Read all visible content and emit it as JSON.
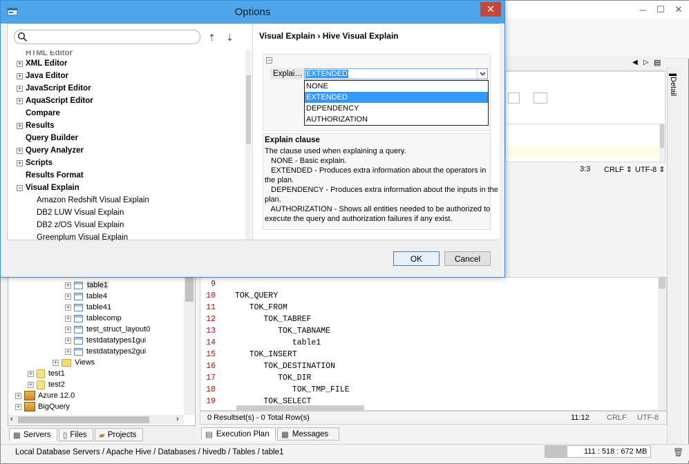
{
  "app": {
    "status_path": "Local Database Servers / Apache Hive / Databases / hivedb / Tables / table1",
    "memory": "111 : 518 : 672 MB",
    "memory_fraction": 0.21,
    "detail_tab": "Detail",
    "editor_status_top": {
      "pos": "3:3",
      "line_ending": "CRLF",
      "encoding": "UTF-8"
    },
    "result_status": {
      "summary": "0 Resultset(s) - 0 Total Row(s)",
      "pos": "11:12",
      "line_ending": "CRLF",
      "encoding": "UTF-8"
    },
    "bottom_tabs_left": [
      "Servers",
      "Files",
      "Projects"
    ],
    "bottom_tabs_right": [
      "Execution Plan",
      "Messages"
    ],
    "tree": [
      {
        "label": "table1",
        "level": 3,
        "type": "table",
        "selected": true
      },
      {
        "label": "table4",
        "level": 3,
        "type": "table"
      },
      {
        "label": "table41",
        "level": 3,
        "type": "table"
      },
      {
        "label": "tablecomp",
        "level": 3,
        "type": "table"
      },
      {
        "label": "test_struct_layout0",
        "level": 3,
        "type": "table"
      },
      {
        "label": "testdatatypes1gui",
        "level": 3,
        "type": "table"
      },
      {
        "label": "testdatatypes2gui",
        "level": 3,
        "type": "table"
      },
      {
        "label": "Views",
        "level": 2,
        "type": "folder"
      },
      {
        "label": "test1",
        "level": 1,
        "type": "db"
      },
      {
        "label": "test2",
        "level": 1,
        "type": "db"
      },
      {
        "label": "Azure 12.0",
        "level": 0,
        "type": "server"
      },
      {
        "label": "BigQuery",
        "level": 0,
        "type": "server"
      }
    ],
    "code_lines": [
      {
        "n": "9",
        "text": ""
      },
      {
        "n": "10",
        "text": "TOK_QUERY"
      },
      {
        "n": "11",
        "text": "   TOK_FROM"
      },
      {
        "n": "12",
        "text": "      TOK_TABREF"
      },
      {
        "n": "13",
        "text": "         TOK_TABNAME"
      },
      {
        "n": "14",
        "text": "            table1"
      },
      {
        "n": "15",
        "text": "   TOK_INSERT"
      },
      {
        "n": "16",
        "text": "      TOK_DESTINATION"
      },
      {
        "n": "17",
        "text": "         TOK_DIR"
      },
      {
        "n": "18",
        "text": "            TOK_TMP_FILE"
      },
      {
        "n": "19",
        "text": "      TOK_SELECT"
      }
    ]
  },
  "dialog": {
    "title": "Options",
    "search_placeholder": "",
    "nav": [
      {
        "label": "HTML Editor",
        "plus": true,
        "bold": true,
        "clipped": true
      },
      {
        "label": "XML Editor",
        "plus": true,
        "bold": true
      },
      {
        "label": "Java Editor",
        "plus": true,
        "bold": true
      },
      {
        "label": "JavaScript Editor",
        "plus": true,
        "bold": true
      },
      {
        "label": "AquaScript Editor",
        "plus": true,
        "bold": true
      },
      {
        "label": "Compare",
        "plus": false,
        "bold": true
      },
      {
        "label": "Results",
        "plus": true,
        "bold": true
      },
      {
        "label": "Query Builder",
        "plus": false,
        "bold": true
      },
      {
        "label": "Query Analyzer",
        "plus": true,
        "bold": true
      },
      {
        "label": "Scripts",
        "plus": true,
        "bold": true
      },
      {
        "label": "Results Format",
        "plus": false,
        "bold": true
      },
      {
        "label": "Visual Explain",
        "plus": false,
        "minus": true,
        "bold": true
      },
      {
        "label": "Amazon Redshift Visual Explain",
        "child": true
      },
      {
        "label": "DB2 LUW Visual Explain",
        "child": true
      },
      {
        "label": "DB2 z/OS Visual Explain",
        "child": true
      },
      {
        "label": "Greenplum Visual Explain",
        "child": true
      }
    ],
    "breadcrumb": "Visual Explain › Hive Visual Explain",
    "property": {
      "label": "Explai…",
      "value": "EXTENDED",
      "options": [
        "NONE",
        "EXTENDED",
        "DEPENDENCY",
        "AUTHORIZATION"
      ],
      "selected_index": 1
    },
    "description": {
      "title": "Explain clause",
      "lines": [
        "The clause used when explaining a query.",
        "   NONE - Basic explain.",
        "   EXTENDED - Produces extra information about the operators in",
        "the plan.",
        "   DEPENDENCY - Produces extra information about the inputs in the",
        "plan.",
        "   AUTHORIZATION - Shows all entities needed to be authorized to",
        "execute the query and authorization failures if any exist."
      ]
    },
    "ok_label": "OK",
    "cancel_label": "Cancel"
  },
  "colors": {
    "title_blue": "#4ea6ea",
    "selection": "#3399ff",
    "close_red": "#c7463b"
  }
}
